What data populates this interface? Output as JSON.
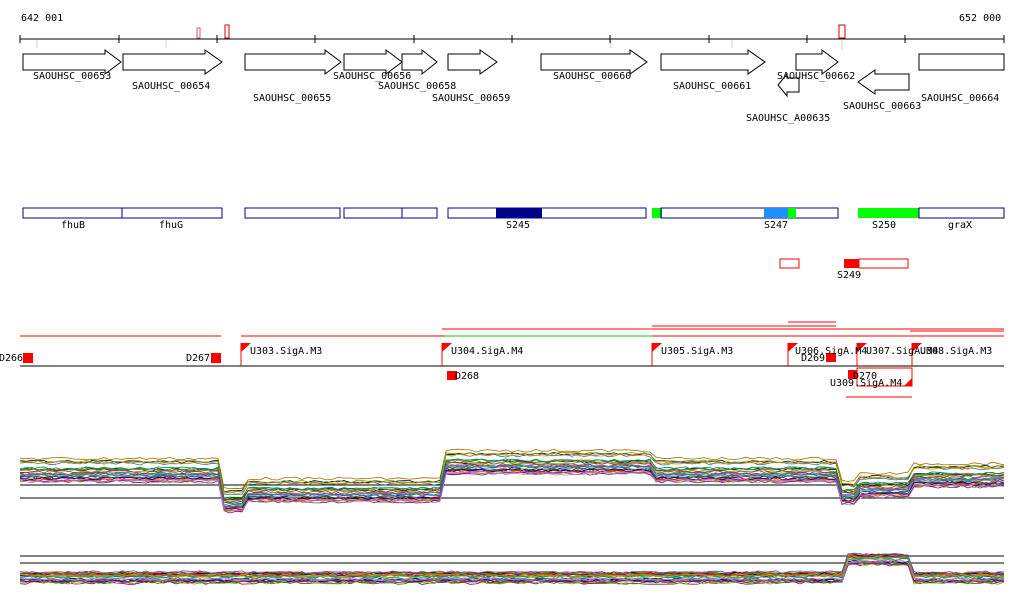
{
  "axis": {
    "start_label": "642 001",
    "end_label": "652 000"
  },
  "genes": [
    {
      "label": "SAOUHSC_00653",
      "strand": "+"
    },
    {
      "label": "SAOUHSC_00654",
      "strand": "+"
    },
    {
      "label": "SAOUHSC_00655",
      "strand": "+"
    },
    {
      "label": "SAOUHSC_00656",
      "strand": "+"
    },
    {
      "label": "SAOUHSC_00658",
      "strand": "+"
    },
    {
      "label": "SAOUHSC_00659",
      "strand": "+"
    },
    {
      "label": "SAOUHSC_00660",
      "strand": "+"
    },
    {
      "label": "SAOUHSC_00661",
      "strand": "+"
    },
    {
      "label": "SAOUHSC_00662",
      "strand": "+"
    },
    {
      "label": "SAOUHSC_A00635",
      "strand": "-"
    },
    {
      "label": "SAOUHSC_00663",
      "strand": "-"
    },
    {
      "label": "SAOUHSC_00664",
      "strand": "+"
    }
  ],
  "gene_names": [
    "fhuB",
    "fhuG",
    "S245",
    "S247",
    "S250",
    "graX",
    "S249"
  ],
  "segments": {
    "down": [
      "D266",
      "D267",
      "D268",
      "D269",
      "D270"
    ],
    "up": [
      "U303.SigA.M3",
      "U304.SigA.M4",
      "U305.SigA.M3",
      "U306.SigA.M4",
      "U307.SigA.M4",
      "U308.SigA.M3",
      "U309.SigA.M4"
    ]
  },
  "colors": {
    "feature_outline": "#00008b",
    "dark_blue_fill": "#00008b",
    "light_blue_fill": "#1e90ff",
    "green_fill": "#00ff00",
    "red": "#ff0000",
    "tick_red": "#cd5c5c",
    "green_line": "#00cc00"
  }
}
